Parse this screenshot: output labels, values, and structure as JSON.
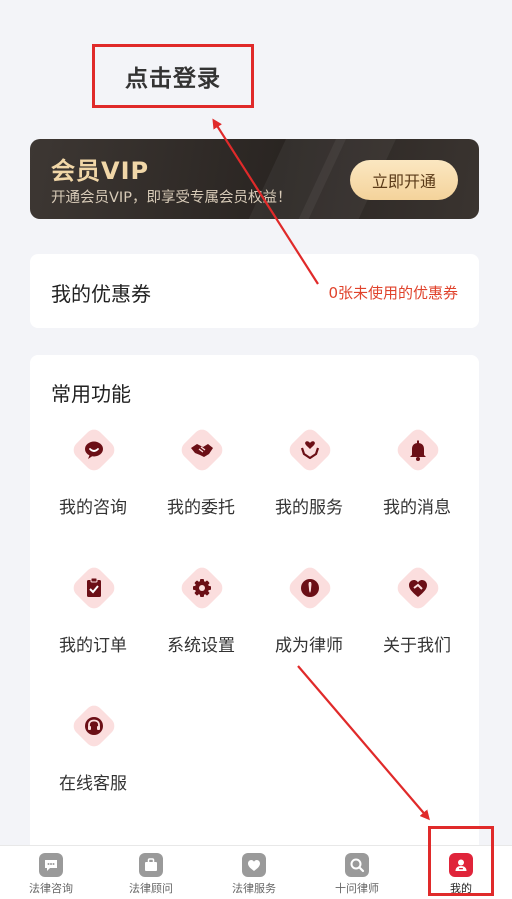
{
  "login": {
    "label": "点击登录"
  },
  "vip": {
    "title": "会员VIP",
    "description": "开通会员VIP，即享受专属会员权益！",
    "button_label": "立即开通"
  },
  "coupon": {
    "title": "我的优惠券",
    "status": "0张未使用的优惠券"
  },
  "functions": {
    "title": "常用功能",
    "items": [
      {
        "label": "我的咨询",
        "icon": "chat-bubble-icon"
      },
      {
        "label": "我的委托",
        "icon": "handshake-icon"
      },
      {
        "label": "我的服务",
        "icon": "heart-hands-icon"
      },
      {
        "label": "我的消息",
        "icon": "bell-icon"
      },
      {
        "label": "我的订单",
        "icon": "clipboard-check-icon"
      },
      {
        "label": "系统设置",
        "icon": "gear-icon"
      },
      {
        "label": "成为律师",
        "icon": "tie-icon"
      },
      {
        "label": "关于我们",
        "icon": "heart-icon"
      },
      {
        "label": "在线客服",
        "icon": "headset-icon"
      }
    ]
  },
  "tabbar": {
    "items": [
      {
        "label": "法律咨询",
        "icon": "chat-icon"
      },
      {
        "label": "法律顾问",
        "icon": "briefcase-icon"
      },
      {
        "label": "法律服务",
        "icon": "heart-icon"
      },
      {
        "label": "十问律师",
        "icon": "search-icon"
      },
      {
        "label": "我的",
        "icon": "user-icon",
        "active": true
      }
    ]
  },
  "colors": {
    "accent": "#e0243a",
    "icon_color": "#6b0f16",
    "icon_bg": "#fbdede",
    "annotation": "#e02a2a"
  }
}
